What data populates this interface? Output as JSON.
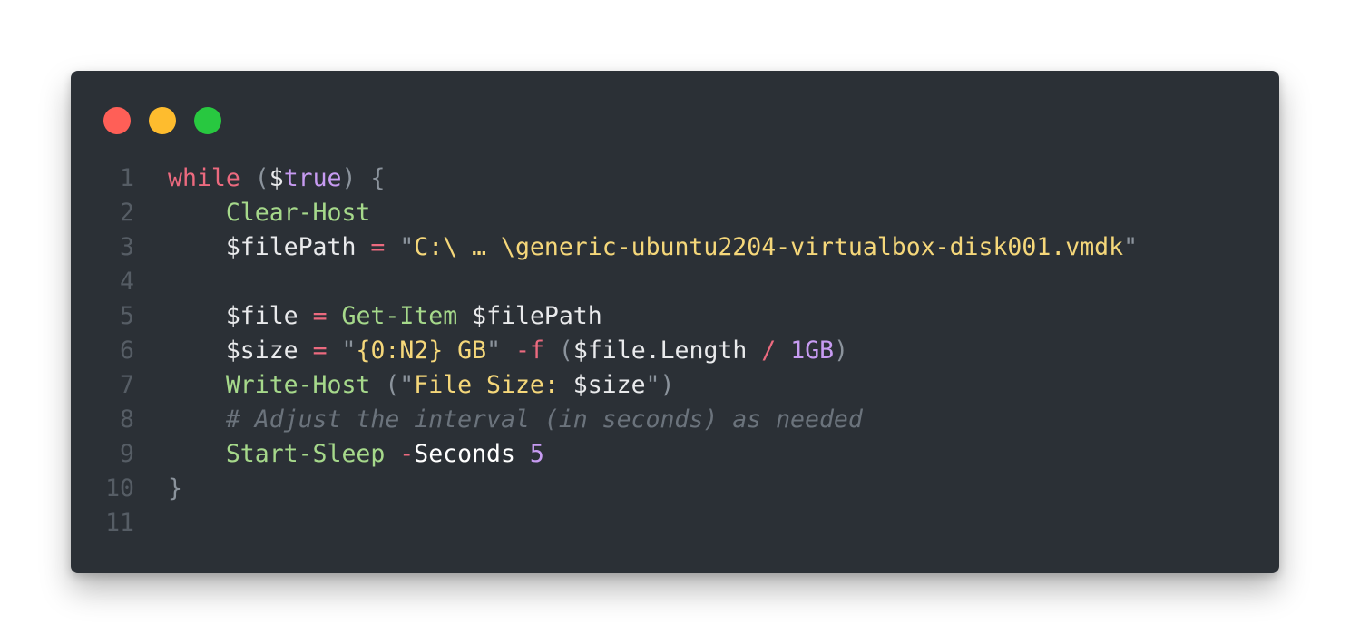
{
  "window": {
    "controls": [
      {
        "name": "close-dot",
        "color": "#ff5f57"
      },
      {
        "name": "minimize-dot",
        "color": "#febc2e"
      },
      {
        "name": "zoom-dot",
        "color": "#28c840"
      }
    ]
  },
  "code": {
    "lines": [
      {
        "number": "1",
        "tokens": [
          {
            "t": "keyword",
            "v": "while"
          },
          {
            "t": "plain",
            "v": " "
          },
          {
            "t": "punct",
            "v": "("
          },
          {
            "t": "var",
            "v": "$"
          },
          {
            "t": "bool",
            "v": "true"
          },
          {
            "t": "punct",
            "v": ")"
          },
          {
            "t": "plain",
            "v": " "
          },
          {
            "t": "punct",
            "v": "{"
          }
        ]
      },
      {
        "number": "2",
        "tokens": [
          {
            "t": "plain",
            "v": "    "
          },
          {
            "t": "func",
            "v": "Clear-Host"
          }
        ]
      },
      {
        "number": "3",
        "tokens": [
          {
            "t": "plain",
            "v": "    "
          },
          {
            "t": "var",
            "v": "$filePath"
          },
          {
            "t": "plain",
            "v": " "
          },
          {
            "t": "op",
            "v": "="
          },
          {
            "t": "plain",
            "v": " "
          },
          {
            "t": "punct",
            "v": "\""
          },
          {
            "t": "str",
            "v": "C:\\ … \\generic-ubuntu2204-virtualbox-disk001.vmdk"
          },
          {
            "t": "punct",
            "v": "\""
          }
        ]
      },
      {
        "number": "4",
        "tokens": []
      },
      {
        "number": "5",
        "tokens": [
          {
            "t": "plain",
            "v": "    "
          },
          {
            "t": "var",
            "v": "$file"
          },
          {
            "t": "plain",
            "v": " "
          },
          {
            "t": "op",
            "v": "="
          },
          {
            "t": "plain",
            "v": " "
          },
          {
            "t": "func",
            "v": "Get-Item"
          },
          {
            "t": "plain",
            "v": " "
          },
          {
            "t": "var",
            "v": "$filePath"
          }
        ]
      },
      {
        "number": "6",
        "tokens": [
          {
            "t": "plain",
            "v": "    "
          },
          {
            "t": "var",
            "v": "$size"
          },
          {
            "t": "plain",
            "v": " "
          },
          {
            "t": "op",
            "v": "="
          },
          {
            "t": "plain",
            "v": " "
          },
          {
            "t": "punct",
            "v": "\""
          },
          {
            "t": "str",
            "v": "{0:N2} GB"
          },
          {
            "t": "punct",
            "v": "\""
          },
          {
            "t": "plain",
            "v": " "
          },
          {
            "t": "op",
            "v": "-f"
          },
          {
            "t": "plain",
            "v": " "
          },
          {
            "t": "punct",
            "v": "("
          },
          {
            "t": "var",
            "v": "$file.Length"
          },
          {
            "t": "plain",
            "v": " "
          },
          {
            "t": "op",
            "v": "/"
          },
          {
            "t": "plain",
            "v": " "
          },
          {
            "t": "num",
            "v": "1GB"
          },
          {
            "t": "punct",
            "v": ")"
          }
        ]
      },
      {
        "number": "7",
        "tokens": [
          {
            "t": "plain",
            "v": "    "
          },
          {
            "t": "func",
            "v": "Write-Host"
          },
          {
            "t": "plain",
            "v": " "
          },
          {
            "t": "punct",
            "v": "(\""
          },
          {
            "t": "str",
            "v": "File Size: "
          },
          {
            "t": "var",
            "v": "$size"
          },
          {
            "t": "punct",
            "v": "\")"
          }
        ]
      },
      {
        "number": "8",
        "tokens": [
          {
            "t": "plain",
            "v": "    "
          },
          {
            "t": "comment",
            "v": "# Adjust the interval (in seconds) as needed"
          }
        ]
      },
      {
        "number": "9",
        "tokens": [
          {
            "t": "plain",
            "v": "    "
          },
          {
            "t": "func",
            "v": "Start-Sleep"
          },
          {
            "t": "plain",
            "v": " "
          },
          {
            "t": "op",
            "v": "-"
          },
          {
            "t": "param",
            "v": "Seconds"
          },
          {
            "t": "plain",
            "v": " "
          },
          {
            "t": "num",
            "v": "5"
          }
        ]
      },
      {
        "number": "10",
        "tokens": [
          {
            "t": "punct",
            "v": "}"
          }
        ]
      },
      {
        "number": "11",
        "tokens": []
      }
    ]
  }
}
